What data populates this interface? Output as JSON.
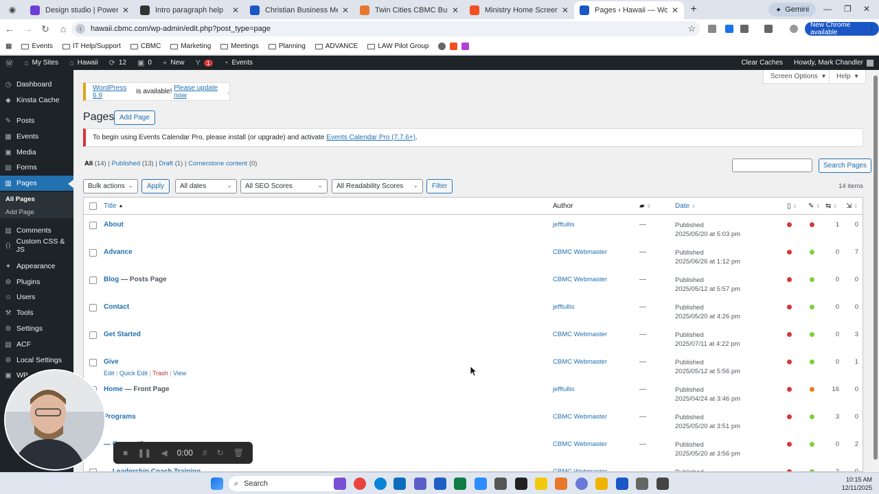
{
  "browser": {
    "tabs": [
      {
        "title": "Design studio | Power Pages",
        "color": "#6b3fd6",
        "active": false
      },
      {
        "title": "Intro paragraph help",
        "color": "#333333",
        "active": false
      },
      {
        "title": "Christian Business Men's Conn",
        "color": "#1a56c4",
        "active": false
      },
      {
        "title": "Twin Cities CBMC Business Ser",
        "color": "#e8772e",
        "active": false
      },
      {
        "title": "Ministry Home Screen (New) - ",
        "color": "#f25022",
        "active": false
      },
      {
        "title": "Pages ‹ Hawaii — WordPre",
        "color": "#1a56c4",
        "active": true
      }
    ],
    "gemini_label": "Gemini",
    "url": "hawaii.cbmc.com/wp-admin/edit.php?post_type=page",
    "new_chrome_label": "New Chrome available",
    "bookmarks": [
      "Events",
      "IT Help/Support",
      "CBMC",
      "Marketing",
      "Meetings",
      "Planning",
      "ADVANCE",
      "LAW Pilot Group"
    ]
  },
  "adminbar": {
    "my_sites": "My Sites",
    "site": "Hawaii",
    "updates": "12",
    "comments": "0",
    "new": "New",
    "yoast_badge": "1",
    "events": "Events",
    "clear_caches": "Clear Caches",
    "howdy": "Howdy, Mark Chandler"
  },
  "sidebar": {
    "items": [
      "Dashboard",
      "Kinsta Cache",
      "Posts",
      "Events",
      "Media",
      "Forms",
      "Pages",
      "Comments",
      "Custom CSS & JS",
      "Appearance",
      "Plugins",
      "Users",
      "Tools",
      "Settings",
      "ACF",
      "Local Settings",
      "WP"
    ],
    "sub_all_pages": "All Pages",
    "sub_add_page": "Add Page"
  },
  "main": {
    "screen_options": "Screen Options",
    "help": "Help",
    "update_notice": {
      "version_link": "WordPress 6.9",
      "middle": " is available! ",
      "update_link": "Please update now",
      "end": "."
    },
    "error_notice": {
      "text": "To begin using Events Calendar Pro, please install (or upgrade) and activate ",
      "link": "Events Calendar Pro (7.7.6+)",
      "end": "."
    },
    "heading": "Pages",
    "add_page": "Add Page",
    "filters": {
      "all": "All",
      "all_count": "(14)",
      "published": "Published",
      "published_count": "(13)",
      "draft": "Draft",
      "draft_count": "(1)",
      "cornerstone": "Cornerstone content",
      "cornerstone_count": "(0)"
    },
    "search_button": "Search Pages",
    "bulk_actions": "Bulk actions",
    "apply": "Apply",
    "all_dates": "All dates",
    "seo_scores": "All SEO Scores",
    "readability": "All Readability Scores",
    "filter": "Filter",
    "items_count": "14 items",
    "columns": {
      "title": "Title",
      "author": "Author",
      "date": "Date"
    },
    "row_actions": {
      "edit": "Edit",
      "quick_edit": "Quick Edit",
      "trash": "Trash",
      "view": "View"
    },
    "rows": [
      {
        "title": "About",
        "state": "",
        "author": "jefftullis",
        "status": "Published",
        "date": "2025/05/20 at 5:03 pm",
        "seo": "#d63638",
        "read": "#d63638",
        "n1": "1",
        "n2": "0"
      },
      {
        "title": "Advance",
        "state": "",
        "author": "CBMC Webmaster",
        "status": "Published",
        "date": "2025/06/26 at 1:12 pm",
        "seo": "#d63638",
        "read": "#7ad03a",
        "n1": "0",
        "n2": "7"
      },
      {
        "title": "Blog",
        "state": " — Posts Page",
        "author": "CBMC Webmaster",
        "status": "Published",
        "date": "2025/05/12 at 5:57 pm",
        "seo": "#d63638",
        "read": "#7ad03a",
        "n1": "0",
        "n2": "0"
      },
      {
        "title": "Contact",
        "state": "",
        "author": "jefftullis",
        "status": "Published",
        "date": "2025/05/20 at 4:26 pm",
        "seo": "#d63638",
        "read": "#7ad03a",
        "n1": "0",
        "n2": "0"
      },
      {
        "title": "Get Started",
        "state": "",
        "author": "CBMC Webmaster",
        "status": "Published",
        "date": "2025/07/11 at 4:22 pm",
        "seo": "#d63638",
        "read": "#7ad03a",
        "n1": "0",
        "n2": "3"
      },
      {
        "title": "Give",
        "state": "",
        "author": "CBMC Webmaster",
        "status": "Published",
        "date": "2025/05/12 at 5:56 pm",
        "seo": "#d63638",
        "read": "#7ad03a",
        "n1": "0",
        "n2": "1"
      },
      {
        "title": "Home",
        "state": " — Front Page",
        "author": "jefftullis",
        "status": "Published",
        "date": "2025/04/24 at 3:46 pm",
        "seo": "#d63638",
        "read": "#ee7c1b",
        "n1": "16",
        "n2": "0"
      },
      {
        "title": "Programs",
        "state": "",
        "author": "CBMC Webmaster",
        "status": "Published",
        "date": "2025/05/20 at 3:51 pm",
        "seo": "#d63638",
        "read": "#7ad03a",
        "n1": "3",
        "n2": "0"
      },
      {
        "title": "— Connect3",
        "state": "",
        "author": "CBMC Webmaster",
        "status": "Published",
        "date": "2025/05/20 at 3:56 pm",
        "seo": "#d63638",
        "read": "#7ad03a",
        "n1": "0",
        "n2": "2"
      },
      {
        "title": "— Leadership Coach Training",
        "state": "",
        "author": "CBMC Webmaster",
        "status": "Published",
        "date": "",
        "seo": "#d63638",
        "read": "#7ad03a",
        "n1": "2",
        "n2": "0"
      }
    ]
  },
  "recorder": {
    "time": "0:00"
  },
  "taskbar": {
    "search": "Search",
    "time": "10:15 AM",
    "date": "12/11/2025"
  }
}
